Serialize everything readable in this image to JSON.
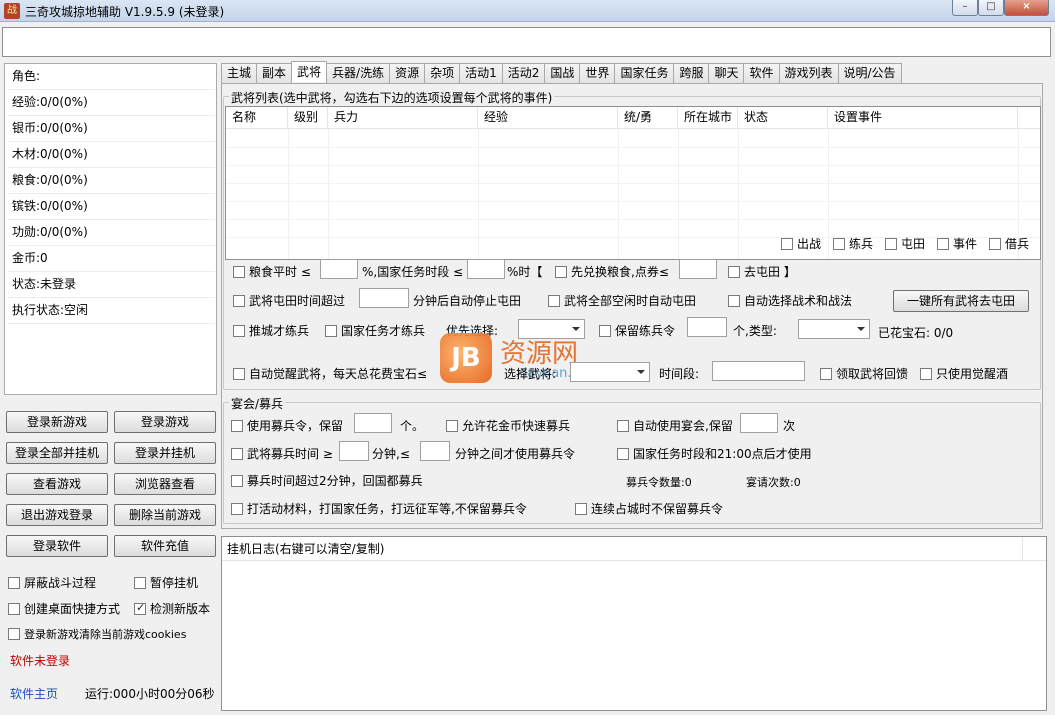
{
  "window": {
    "title": "三奇攻城掠地辅助 V1.9.5.9 (未登录)",
    "icon": "app-logo-icon",
    "minimize": "–",
    "maximize": "□",
    "close": "×"
  },
  "url_bar": {
    "value": ""
  },
  "stats": [
    "角色:",
    "经验:0/0(0%)",
    "银币:0/0(0%)",
    "木材:0/0(0%)",
    "粮食:0/0(0%)",
    "镔铁:0/0(0%)",
    "功勋:0/0(0%)",
    "金币:0",
    "状态:未登录",
    "执行状态:空闲"
  ],
  "left_buttons": {
    "login_new_game": "登录新游戏",
    "login_game": "登录游戏",
    "login_all_hang": "登录全部并挂机",
    "login_hang": "登录并挂机",
    "view_game": "查看游戏",
    "browser_view": "浏览器查看",
    "logout_game": "退出游戏登录",
    "delete_game": "删除当前游戏",
    "login_software": "登录软件",
    "recharge": "软件充值"
  },
  "left_options": {
    "block_battle": {
      "label": "屏蔽战斗过程",
      "checked": false
    },
    "pause_hang": {
      "label": "暂停挂机",
      "checked": false
    },
    "desktop_shortcut": {
      "label": "创建桌面快捷方式",
      "checked": false
    },
    "check_version": {
      "label": "检测新版本",
      "checked": true
    },
    "clear_cookies": {
      "label": "登录新游戏清除当前游戏cookies",
      "checked": false
    }
  },
  "status": {
    "software_status": "软件未登录",
    "home_link": "软件主页",
    "runtime": "运行:000小时00分06秒"
  },
  "tabs": [
    "主城",
    "副本",
    "武将",
    "兵器/洗练",
    "资源",
    "杂项",
    "活动1",
    "活动2",
    "国战",
    "世界",
    "国家任务",
    "跨服",
    "聊天",
    "软件",
    "游戏列表",
    "说明/公告"
  ],
  "active_tab": "武将",
  "general_list": {
    "title": "武将列表(选中武将，勾选右下边的选项设置每个武将的事件)",
    "columns": [
      "名称",
      "级别",
      "兵力",
      "经验",
      "统/勇",
      "所在城市",
      "状态",
      "设置事件"
    ],
    "rows": []
  },
  "event_checks": [
    "出战",
    "练兵",
    "屯田",
    "事件",
    "借兵"
  ],
  "general_options": {
    "grain_flat_a": "粮食平时 ≤",
    "grain_flat_b": "%,国家任务时段 ≤",
    "grain_flat_c": "%时【",
    "exchange_grain": "先兑换粮食,点券≤",
    "go_farm": "去屯田 】",
    "farm_time_a": "武将屯田时间超过",
    "farm_time_b": "分钟后自动停止屯田",
    "auto_farm_idle": "武将全部空闲时自动屯田",
    "auto_tactics": "自动选择战术和战法",
    "all_farm_button": "一键所有武将去屯田",
    "train_after_city": "推城才练兵",
    "train_after_task": "国家任务才练兵",
    "priority_label": "优先选择:",
    "keep_train_token_a": "保留练兵令",
    "keep_train_token_b": "个,类型:",
    "spent_gems": "已花宝石: 0/0",
    "auto_awaken": "自动觉醒武将，每天总花费宝石≤",
    "select_general": "选择武将:",
    "time_period": "时间段:",
    "receive_reward": "领取武将回馈",
    "only_awaken_wine": "只使用觉醒酒"
  },
  "banquet": {
    "title": "宴会/募兵",
    "use_recruit_a": "使用募兵令，保留",
    "use_recruit_b": "个。",
    "allow_gold": "允许花金币快速募兵",
    "auto_banquet_a": "自动使用宴会,保留",
    "auto_banquet_b": "次",
    "recruit_time_a": "武将募兵时间 ≥",
    "recruit_time_b": "分钟,≤",
    "recruit_time_c": "分钟之间才使用募兵令",
    "after_task": "国家任务时段和21:00点后才使用",
    "over_2min": "募兵时间超过2分钟，回国都募兵",
    "recruit_token_count": "募兵令数量:0",
    "banquet_count": "宴请次数:0",
    "event_material": "打活动材料，打国家任务，打远征军等,不保留募兵令",
    "continuous_occupy": "连续占城时不保留募兵令"
  },
  "log": {
    "title": "挂机日志(右键可以清空/复制)"
  },
  "watermark": {
    "icon_letter": "JB",
    "text": "资源网",
    "sub": "xiayuan.com"
  }
}
